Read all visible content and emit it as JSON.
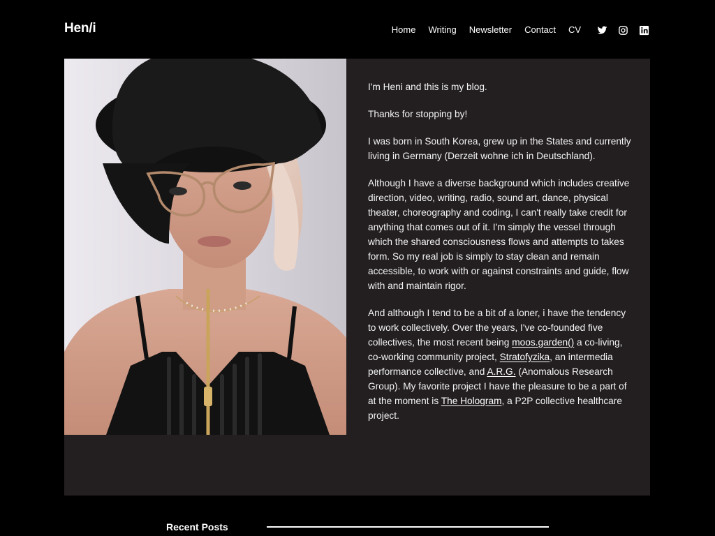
{
  "site": {
    "title": "Hen/i"
  },
  "nav": {
    "items": [
      {
        "label": "Home"
      },
      {
        "label": "Writing"
      },
      {
        "label": "Newsletter"
      },
      {
        "label": "Contact"
      },
      {
        "label": "CV"
      }
    ],
    "social": [
      {
        "icon": "twitter-icon"
      },
      {
        "icon": "instagram-icon"
      },
      {
        "icon": "linkedin-icon"
      }
    ]
  },
  "bio": {
    "p1": "I'm Heni and this is my blog.",
    "p2": "Thanks for stopping by!",
    "p3": "I was born in South Korea, grew up in the States and currently living in Germany (Derzeit wohne ich in Deutschland).",
    "p4": "Although I have a diverse background which includes creative direction, video, writing, radio, sound art, dance, physical theater, choreography and coding,  I can't really take credit for anything that comes out of it. I'm simply the vessel through which the shared consciousness flows and attempts to takes form. So my real job is simply to stay clean and remain accessible, to work with or against constraints and guide, flow with and maintain rigor.",
    "p5": {
      "intro": "And although I tend to be a bit of a loner, i have the tendency to work collectively. Over the years, I've co-founded five collectives, the most recent being ",
      "link1": "moos.garden()",
      "text1": " a co-living, co-working community project, ",
      "link2": "Stratofyzika",
      "text2": ", an intermedia performance collective,  and ",
      "link3": "A.R.G.",
      "text3": " (Anomalous Research Group). My favorite project I have the pleasure to be a part of at the moment is ",
      "link4": "The Hologram",
      "text4": ", a P2P collective healthcare project."
    }
  },
  "recent_posts": {
    "label": "Recent Posts"
  },
  "colors": {
    "background": "#000000",
    "card": "#231f20",
    "text": "#ffffff"
  }
}
